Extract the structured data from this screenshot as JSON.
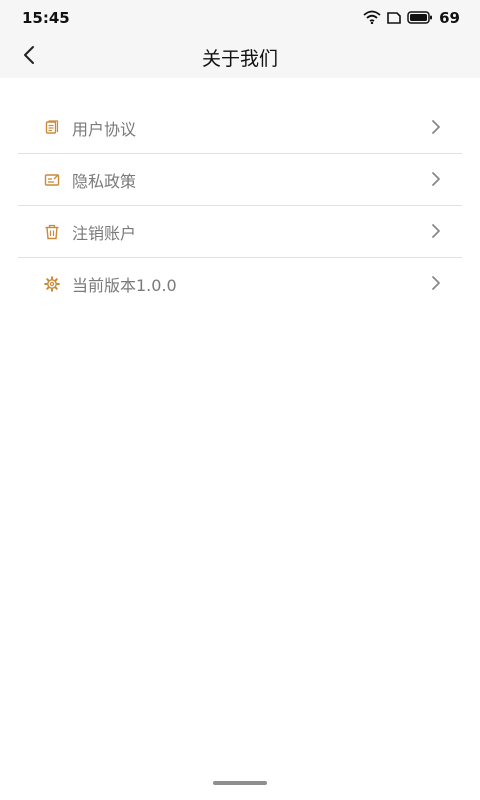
{
  "status_bar": {
    "time": "15:45",
    "battery": "69",
    "icons": [
      "wifi-icon",
      "sim-icon",
      "battery-icon"
    ]
  },
  "header": {
    "title": "关于我们",
    "back_icon": "chevron-left-icon"
  },
  "menu": {
    "accent_color": "#c98a3a",
    "items": [
      {
        "label": "用户协议",
        "icon": "document-icon"
      },
      {
        "label": "隐私政策",
        "icon": "edit-note-icon"
      },
      {
        "label": "注销账户",
        "icon": "trash-icon"
      },
      {
        "label": "当前版本1.0.0",
        "icon": "gear-icon"
      }
    ]
  }
}
